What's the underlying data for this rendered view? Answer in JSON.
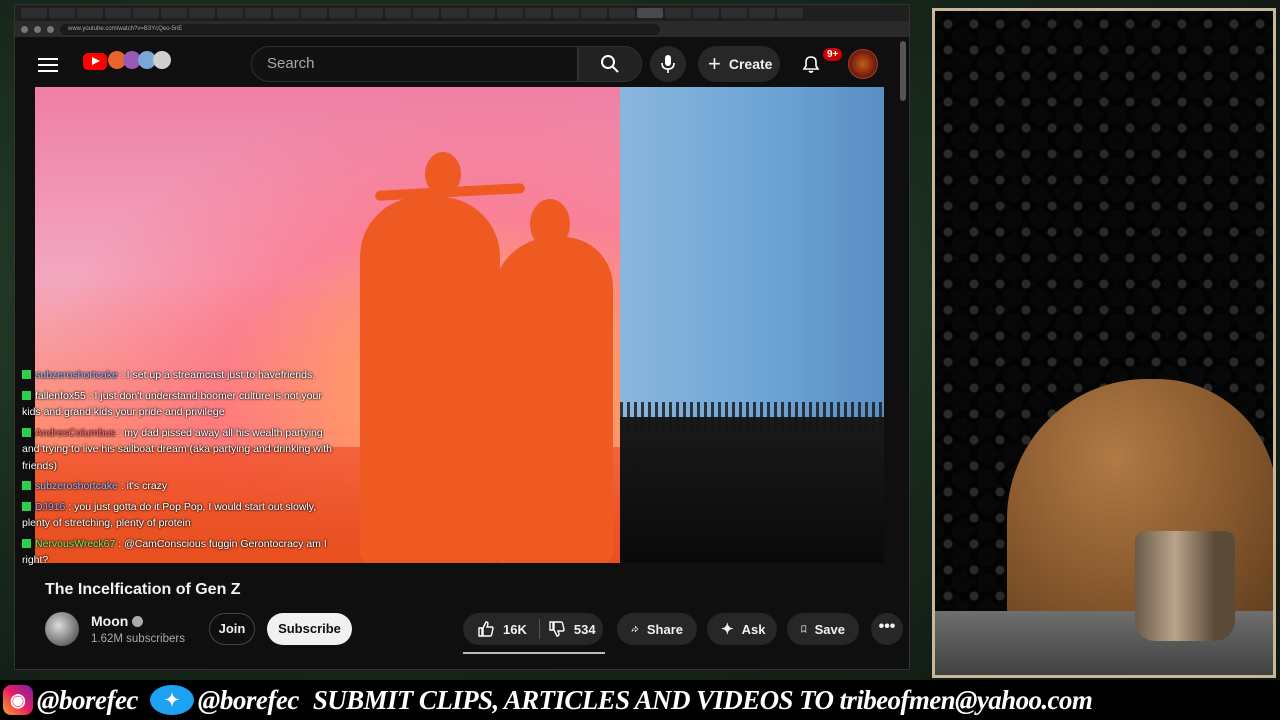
{
  "browser": {
    "url": "www.youtube.com/watch?v=B3YcQeo-5nE"
  },
  "header": {
    "search_placeholder": "Search",
    "create_label": "Create",
    "notifications_badge": "9+"
  },
  "chat": [
    {
      "user": "subzeroshortcake",
      "color": "blue",
      "text": ": I set up a streamcast just to havefriends."
    },
    {
      "user": "fallenfox55",
      "color": "white",
      "text": ": I just don't understand boomer culture is not your kids and grand kids your pride and privilege"
    },
    {
      "user": "AndresColumbus",
      "color": "red",
      "text": ": my dad pissed away all his wealth partying and trying to live his sailboat dream (aka partying and drinking with friends)"
    },
    {
      "user": "subzeroshortcake",
      "color": "blue",
      "text": ": it's crazy"
    },
    {
      "user": "DJ916",
      "color": "blue2",
      "text": ": you just gotta do it Pop Pop, I would start out slowly, plenty of stretching, plenty of protein"
    },
    {
      "user": "NervousWreck67",
      "color": "green",
      "text": ": @CamConscious fuggin Gerontocracy am I right?"
    }
  ],
  "video": {
    "title": "The Incelfication of Gen Z",
    "channel_name": "Moon",
    "subscribers": "1.62M subscribers",
    "join_label": "Join",
    "subscribe_label": "Subscribe",
    "likes": "16K",
    "dislikes": "534",
    "share_label": "Share",
    "ask_label": "Ask",
    "save_label": "Save",
    "more_label": "•••"
  },
  "banner": {
    "instagram_handle": "@borefec",
    "twitter_handle": "@borefec",
    "submit_text": "SUBMIT CLIPS, ARTICLES AND VIDEOS TO tribeofmen@yahoo.com"
  },
  "colors": {
    "youtube_red": "#ff0000",
    "subscribe_bg": "#f1f1f1",
    "chat_badge": "#2bd14a"
  }
}
